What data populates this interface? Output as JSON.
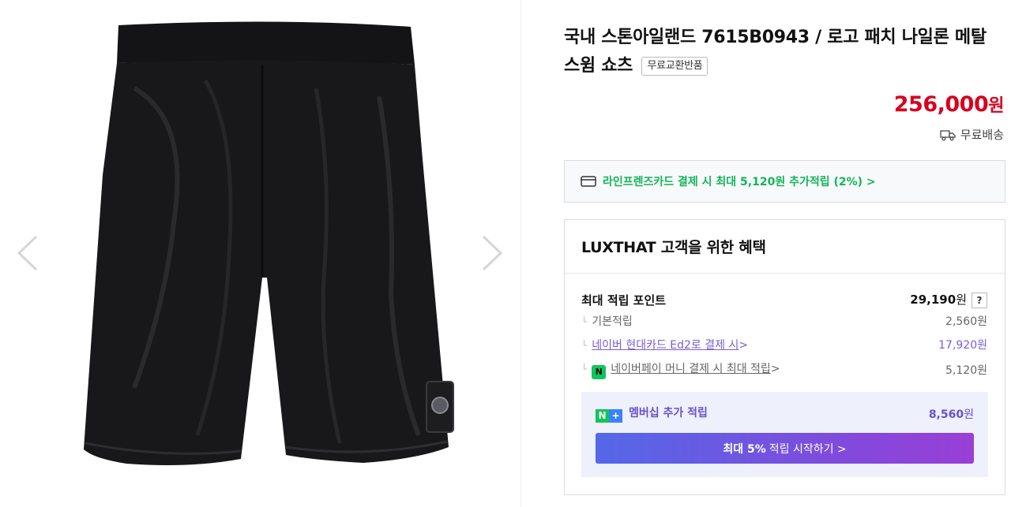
{
  "product": {
    "title": "국내 스톤아일랜드 7615B0943 / 로고 패치 나일론 메탈 스윔 쇼츠",
    "badge": "무료교환반품",
    "price": "256,000",
    "price_unit": "원",
    "shipping": "무료배송"
  },
  "card_banner": {
    "text": "라인프렌즈카드 결제 시 최대 5,120원 추가적립 (2%) >"
  },
  "benefit": {
    "title": "LUXTHAT 고객을 위한 혜택",
    "max_points_label": "최대 적립 포인트",
    "max_points_value": "29,190",
    "max_points_unit": "원",
    "help_label": "?",
    "rows": [
      {
        "label": "기본적립",
        "value": "2,560원"
      },
      {
        "label": "네이버 현대카드 Ed2로 결제 시",
        "value": "17,920원"
      },
      {
        "label": "네이버페이 머니 결제 시 최대 적립",
        "value": "5,120원"
      }
    ],
    "membership": {
      "label": "멤버십 추가 적립",
      "value": "8,560",
      "unit": "원",
      "button_bold": "최대 5%",
      "button_rest": "적립 시작하기 >"
    }
  },
  "icons": {
    "npay_glyph": "N",
    "nplus_n": "N",
    "nplus_plus": "+",
    "chevron": ">"
  },
  "colors": {
    "price": "#d7021f",
    "card_banner_text": "#12b55a",
    "membership_text": "#6a4fd0",
    "button_gradient_start": "#5468e8",
    "button_gradient_end": "#9a3fd6"
  }
}
